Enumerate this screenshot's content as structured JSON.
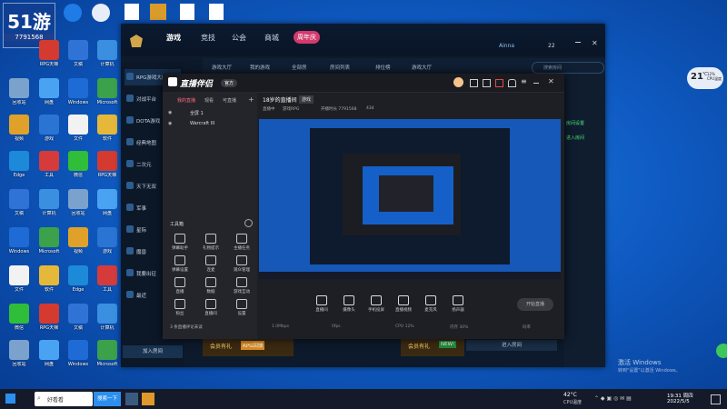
{
  "desktop": {
    "watermark_logo": "51游",
    "watermark_id": "7791568",
    "icons_left": [
      {
        "label": "RPG天梯",
        "color": "#d43a2f"
      },
      {
        "label": "文稿",
        "color": "#2f73d6"
      },
      {
        "label": "计算机",
        "color": "#3a8fe0"
      },
      {
        "label": "回收站",
        "color": "#7aa2cc"
      },
      {
        "label": "网盘",
        "color": "#4aa3f2"
      },
      {
        "label": "Windows",
        "color": "#1e6bd6"
      },
      {
        "label": "Microsoft",
        "color": "#3ba14a"
      },
      {
        "label": "视频",
        "color": "#e0a12a"
      },
      {
        "label": "游戏",
        "color": "#2a74d4"
      },
      {
        "label": "文件",
        "color": "#f2f2f2"
      },
      {
        "label": "软件",
        "color": "#e6b83a"
      },
      {
        "label": "Edge",
        "color": "#1c8ad8"
      },
      {
        "label": "工具",
        "color": "#d53b3b"
      },
      {
        "label": "微信",
        "color": "#2fbd3a"
      }
    ],
    "recycle_label": "回收站"
  },
  "game_window": {
    "nav": {
      "game": "游戏",
      "competition": "竞技",
      "guild": "公会",
      "mall": "商城",
      "badge": "周年庆"
    },
    "user": "Ainna",
    "coins": "22",
    "subtabs": [
      "游戏大厅",
      "我的游戏",
      "全部房",
      "房间列表",
      "排位榜",
      "游戏大厅"
    ],
    "search_placeholder": "搜索房间",
    "sidebar": [
      "RPG游戏大厅",
      "对战平台",
      "DOTA游戏",
      "经典地图",
      "二次元",
      "天下无双",
      "军事",
      "星际",
      "魔兽",
      "我要出征",
      "最近"
    ],
    "bottom_button": "加入房间",
    "right_panel": {
      "green_btn1": "房间设置",
      "green_btn2": "进入房间"
    },
    "promo1": {
      "text": "会员有礼",
      "tag": "RPG回馈"
    },
    "promo2": {
      "text": "会员有礼",
      "tag": "NEW!"
    },
    "promo3": "进入房间"
  },
  "streamer": {
    "title": "直播伴侣",
    "badge": "官方",
    "tabs": [
      "我的直播",
      "观看",
      "可直播"
    ],
    "scene_items": [
      "全屏 1",
      "Warcraft III"
    ],
    "tool_section": "工具箱",
    "tools": [
      "弹幕助手",
      "礼物提示",
      "主播任务",
      "弹幕设置",
      "连麦",
      "观众管理",
      "直播",
      "数据",
      "游戏互动",
      "粉丝",
      "直播间",
      "设置"
    ],
    "footer_note": "3 条直播评论未读",
    "stream_title": "18岁的直播间",
    "stream_tag": "游戏",
    "stream_info": [
      "直播中",
      "游戏RPG",
      "开播时长 7791568",
      "434"
    ],
    "bottom_tools": [
      "直播间",
      "摄像头",
      "手机投屏",
      "直播视频",
      "麦克风",
      "扬声器"
    ],
    "start_button": "开始直播",
    "status_bar": [
      "1.0Mbps",
      "0fps",
      "CPU 12%",
      "内存 30%",
      "码率"
    ]
  },
  "weather_widget": {
    "temp": "21",
    "unit": "℃",
    "cpu": "12%\nCPU温度"
  },
  "taskbar": {
    "search_text": "好看看",
    "search_btn": "搜索一下",
    "weather": "42°C",
    "weather_sub": "CPU温度",
    "time": "19:31 周四",
    "date": "2022/5/5",
    "activate": "激活 Windows",
    "activate_sub": "转到\"设置\"以激活 Windows。"
  }
}
